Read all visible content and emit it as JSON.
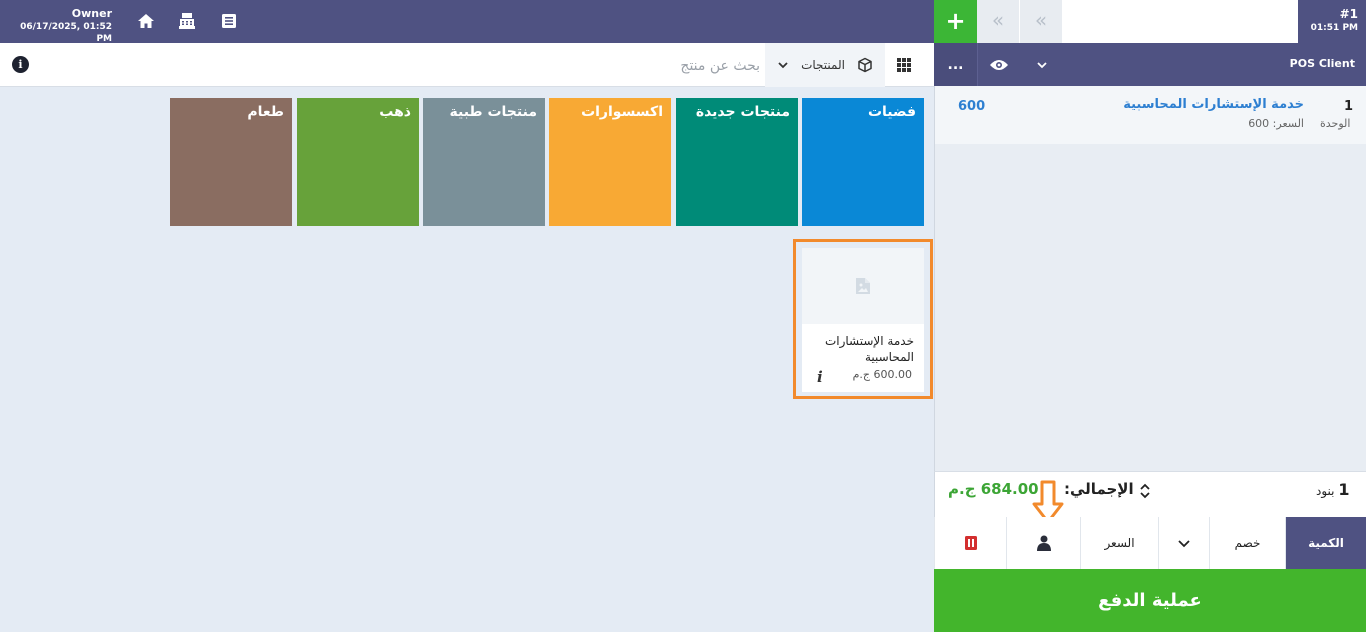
{
  "header": {
    "user_name": "Owner",
    "datetime": "06/17/2025, 01:52 PM",
    "icons": [
      "home-icon",
      "cash-register-icon",
      "receipt-icon"
    ]
  },
  "search": {
    "placeholder": "بحث عن منتج",
    "products_dropdown_label": "المنتجات"
  },
  "categories": [
    {
      "label": "فضيات",
      "color": "#0a88d6"
    },
    {
      "label": "منتجات جديدة",
      "color": "#008b78"
    },
    {
      "label": "اكسسوارات",
      "color": "#f8a934"
    },
    {
      "label": "منتجات طبية",
      "color": "#7a9099"
    },
    {
      "label": "ذهب",
      "color": "#67a23a"
    },
    {
      "label": "طعام",
      "color": "#8a6d61"
    }
  ],
  "product_card": {
    "name": "خدمة الإستشارات المحاسبية",
    "price": "600.00 ج.م",
    "info": "i"
  },
  "order": {
    "number": "#1",
    "time": "01:51 PM",
    "add_label": "+",
    "prev_label": "«",
    "next_label": "«",
    "client_name": "POS Client",
    "more_label": "..."
  },
  "line_items": [
    {
      "qty": "1",
      "unit": "الوحدة",
      "name": "خدمة الإستشارات المحاسبية",
      "price_text": "السعر: 600",
      "total": "600"
    }
  ],
  "totals": {
    "items_count": "1",
    "items_label": "بنود",
    "total_label": "الإجمالي:",
    "total_value": "684.00 ج.م"
  },
  "actions": {
    "quantity": "الكمية",
    "discount": "خصم",
    "price": "السعر",
    "pay": "عملية الدفع"
  },
  "colors": {
    "header": "#4f5282",
    "accent_green": "#3cb636",
    "highlight": "#f28a2c"
  }
}
